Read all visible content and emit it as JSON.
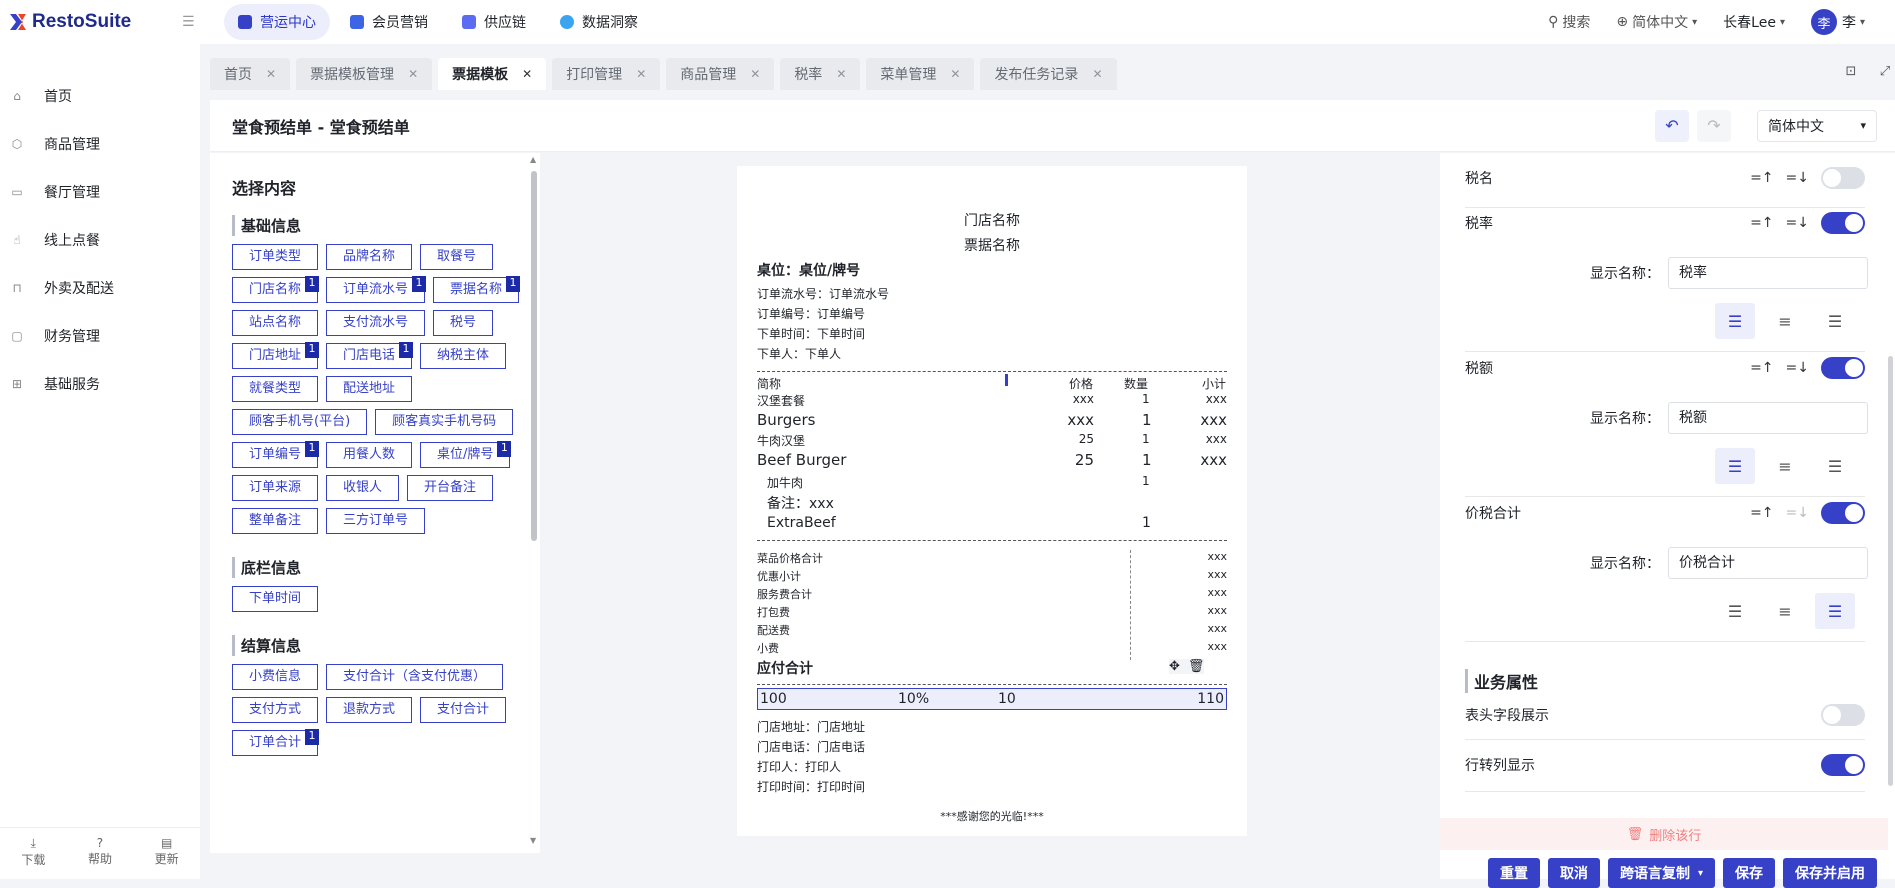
{
  "app": {
    "logo_text": "RestoSuite"
  },
  "topnav": [
    "营运中心",
    "会员营销",
    "供应链",
    "数据洞察"
  ],
  "topright": {
    "search": "搜索",
    "language": "简体中文",
    "user": "长春Lee",
    "avatar": "李",
    "avatar_name": "李"
  },
  "sidebar": [
    "首页",
    "商品管理",
    "餐厅管理",
    "线上点餐",
    "外卖及配送",
    "财务管理",
    "基础服务"
  ],
  "sidebar_bottom": [
    "下载",
    "帮助",
    "更新"
  ],
  "tabs": [
    "首页",
    "票据模板管理",
    "票据模板",
    "打印管理",
    "商品管理",
    "税率",
    "菜单管理",
    "发布任务记录"
  ],
  "page": {
    "title": "堂食预结单 - 堂食预结单",
    "language": "简体中文"
  },
  "left": {
    "title": "选择内容",
    "sections": [
      {
        "title": "基础信息",
        "chips": [
          {
            "label": "订单类型"
          },
          {
            "label": "品牌名称"
          },
          {
            "label": "取餐号"
          },
          {
            "label": "门店名称",
            "badge": "1"
          },
          {
            "label": "订单流水号",
            "badge": "1"
          },
          {
            "label": "票据名称",
            "badge": "1"
          },
          {
            "label": "站点名称"
          },
          {
            "label": "支付流水号"
          },
          {
            "label": "税号"
          },
          {
            "label": "门店地址",
            "badge": "1"
          },
          {
            "label": "门店电话",
            "badge": "1"
          },
          {
            "label": "纳税主体"
          },
          {
            "label": "就餐类型"
          },
          {
            "label": "配送地址"
          },
          {
            "label": "顾客手机号(平台)"
          },
          {
            "label": "顾客真实手机号码"
          },
          {
            "label": "订单编号",
            "badge": "1"
          },
          {
            "label": "用餐人数"
          },
          {
            "label": "桌位/牌号",
            "badge": "1"
          },
          {
            "label": "订单来源"
          },
          {
            "label": "收银人"
          },
          {
            "label": "开台备注"
          },
          {
            "label": "整单备注"
          },
          {
            "label": "三方订单号"
          }
        ]
      },
      {
        "title": "底栏信息",
        "chips": [
          {
            "label": "下单时间"
          }
        ]
      },
      {
        "title": "结算信息",
        "chips": [
          {
            "label": "小费信息"
          },
          {
            "label": "支付合计（含支付优惠）"
          },
          {
            "label": "支付方式"
          },
          {
            "label": "退款方式"
          },
          {
            "label": "支付合计"
          },
          {
            "label": "订单合计",
            "badge": "1"
          }
        ]
      }
    ]
  },
  "receipt": {
    "store_name": "门店名称",
    "receipt_name": "票据名称",
    "table": "桌位：桌位/牌号",
    "info": [
      "订单流水号：订单流水号",
      "订单编号：订单编号",
      "下单时间：下单时间",
      "下单人：下单人"
    ],
    "cols": {
      "name": "简称",
      "price": "价格",
      "qty": "数量",
      "subtotal": "小计"
    },
    "rows": [
      {
        "name": "汉堡套餐",
        "price": "xxx",
        "qty": "1",
        "sub": "xxx",
        "big": false
      },
      {
        "name": "Burgers",
        "price": "xxx",
        "qty": "1",
        "sub": "xxx",
        "big": true
      },
      {
        "name": "牛肉汉堡",
        "price": "25",
        "qty": "1",
        "sub": "xxx",
        "big": false
      },
      {
        "name": "Beef Burger",
        "price": "25",
        "qty": "1",
        "sub": "xxx",
        "big": true
      }
    ],
    "addon": "加牛肉",
    "addon_qty": "1",
    "note": "备注：xxx",
    "extra": "ExtraBeef",
    "extra_qty": "1",
    "totals": [
      {
        "l": "菜品价格合计",
        "v": "xxx"
      },
      {
        "l": "优惠小计",
        "v": "xxx"
      },
      {
        "l": "服务费合计",
        "v": "xxx"
      },
      {
        "l": "打包费",
        "v": "xxx"
      },
      {
        "l": "配送费",
        "v": "xxx"
      },
      {
        "l": "小费",
        "v": "xxx"
      }
    ],
    "payable": "应付合计",
    "tax_row": [
      "100",
      "10%",
      "10",
      "110"
    ],
    "footer": [
      "门店地址：门店地址",
      "门店电话：门店电话",
      "打印人：打印人",
      "打印时间：打印时间"
    ],
    "thanks": "***感谢您的光临!***"
  },
  "right": {
    "f1": "税名",
    "f2": "税率",
    "f3": "税额",
    "f4": "价税合计",
    "disp_label": "显示名称：",
    "v2": "税率",
    "v3": "税额",
    "v4": "价税合计",
    "biz_title": "业务属性",
    "b1": "表头字段展示",
    "b2": "行转列显示",
    "delete": "删除该行"
  },
  "footer_buttons": [
    "重置",
    "取消",
    "跨语言复制",
    "保存",
    "保存并启用"
  ]
}
